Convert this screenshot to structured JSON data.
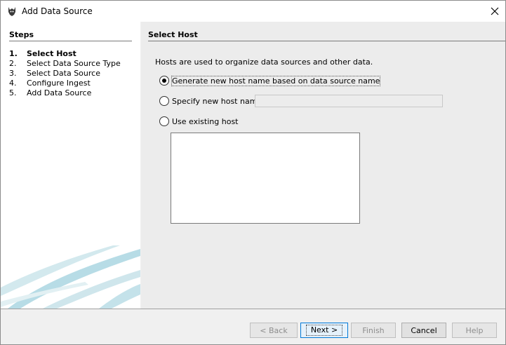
{
  "window": {
    "title": "Add Data Source",
    "icon": "app-icon"
  },
  "steps": {
    "heading": "Steps",
    "items": [
      {
        "num": "1.",
        "label": "Select Host",
        "active": true
      },
      {
        "num": "2.",
        "label": "Select Data Source Type",
        "active": false
      },
      {
        "num": "3.",
        "label": "Select Data Source",
        "active": false
      },
      {
        "num": "4.",
        "label": "Configure Ingest",
        "active": false
      },
      {
        "num": "5.",
        "label": "Add Data Source",
        "active": false
      }
    ]
  },
  "main": {
    "heading": "Select Host",
    "description": "Hosts are used to organize data sources and other data.",
    "options": {
      "generate": {
        "label": "Generate new host name based on data source name",
        "checked": true
      },
      "specify": {
        "label": "Specify new host name",
        "checked": false,
        "value": "",
        "placeholder": ""
      },
      "existing": {
        "label": "Use existing host",
        "checked": false
      }
    },
    "host_list": []
  },
  "buttons": {
    "back": "< Back",
    "next": "Next >",
    "finish": "Finish",
    "cancel": "Cancel",
    "help": "Help"
  }
}
